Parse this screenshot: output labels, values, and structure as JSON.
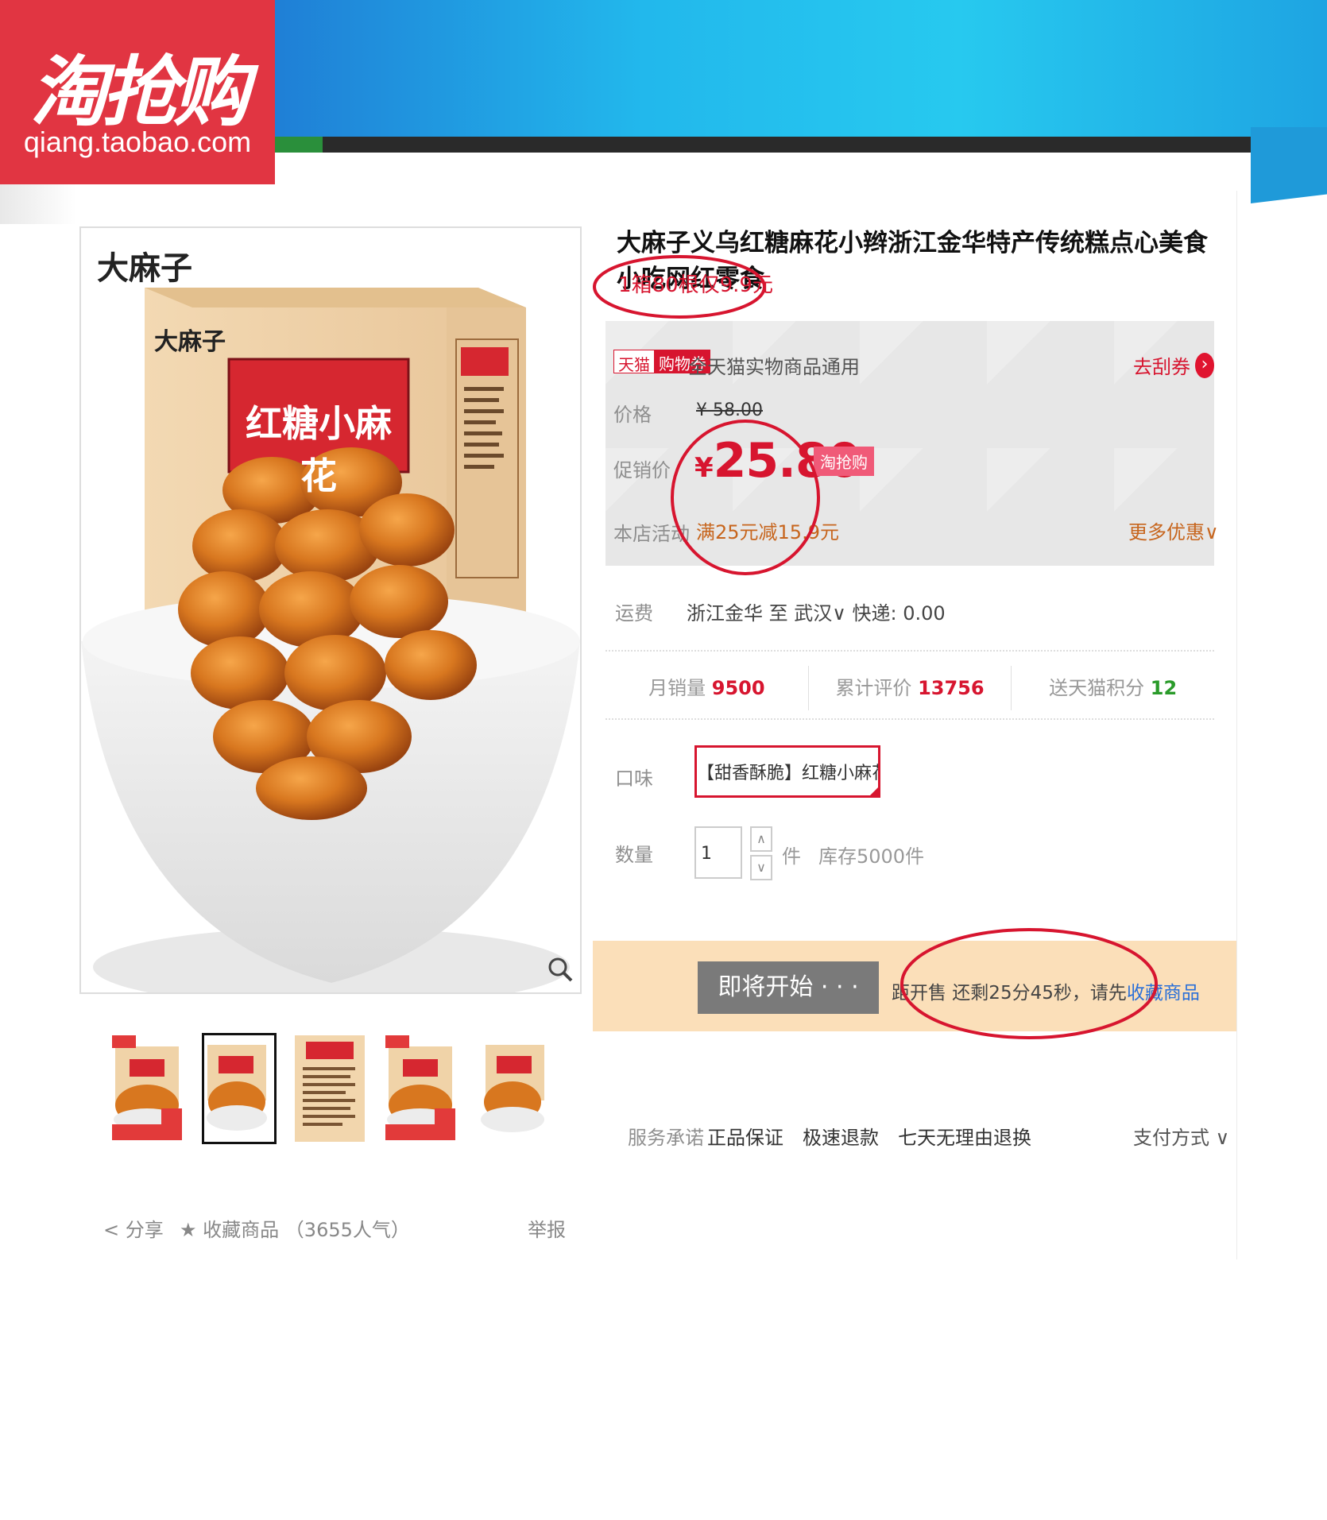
{
  "header": {
    "logo_cn": "淘抢购",
    "logo_url_text": "qiang.taobao.com",
    "brand_color": "#e13542",
    "band_color": "#22b8ec"
  },
  "product": {
    "title": "大麻子义乌红糖麻花小辫浙江金华特产传统糕点心美食小吃网红零食",
    "subtitle": "1箱80根仅9.9元",
    "image_brand": "大麻子",
    "image_label": "红糖小麻花"
  },
  "promo": {
    "badge_tmall": "天猫",
    "badge_coupon": "购物券",
    "coupon_text": "全天猫实物商品通用",
    "coupon_link": "去刮券",
    "price_label": "价格",
    "original_price": "¥ 58.00",
    "promo_label": "促销价",
    "currency": "¥",
    "promo_price": "25.80",
    "promo_badge": "淘抢购",
    "activity_label": "本店活动",
    "activity_text": "满25元减15.9元",
    "more_deals": "更多优惠",
    "accent_color": "#d7152f"
  },
  "shipping": {
    "label": "运费",
    "from": "浙江金华",
    "to_prefix": "至",
    "to": "武汉",
    "express": "快递: 0.00"
  },
  "stats": {
    "monthly_label": "月销量",
    "monthly_value": "9500",
    "reviews_label": "累计评价",
    "reviews_value": "13756",
    "points_label": "送天猫积分",
    "points_value": "12"
  },
  "options": {
    "flavor_label": "口味",
    "flavor_value": "【甜香酥脆】红糖小麻花",
    "qty_label": "数量",
    "qty_value": "1",
    "qty_unit": "件",
    "stock": "库存5000件"
  },
  "buy": {
    "button_label": "即将开始 · · ·",
    "countdown_prefix": "距开售 还剩25分45秒，请先",
    "countdown_link": "收藏商品"
  },
  "service": {
    "label": "服务承诺",
    "items": [
      "正品保证",
      "极速退款",
      "七天无理由退换"
    ],
    "pay": "支付方式"
  },
  "footer": {
    "share": "分享",
    "collect": "收藏商品",
    "collect_count": "（3655人气）",
    "report": "举报"
  },
  "thumbnails": [
    {
      "name": "thumb-1",
      "caption_top": "红糖小麻花",
      "caption_bottom": "9.9元",
      "badge": "80根"
    },
    {
      "name": "thumb-2",
      "caption_top": "红糖小麻花",
      "caption_bottom": "",
      "badge": ""
    },
    {
      "name": "thumb-3",
      "caption_top": "红糖小麻花",
      "caption_bottom": "",
      "badge": ""
    },
    {
      "name": "thumb-4",
      "caption_top": "红糖小麻花",
      "caption_bottom": "9.9元",
      "badge": "80根"
    },
    {
      "name": "thumb-5",
      "caption_top": "红糖小麻花",
      "caption_bottom": "",
      "badge": ""
    }
  ]
}
